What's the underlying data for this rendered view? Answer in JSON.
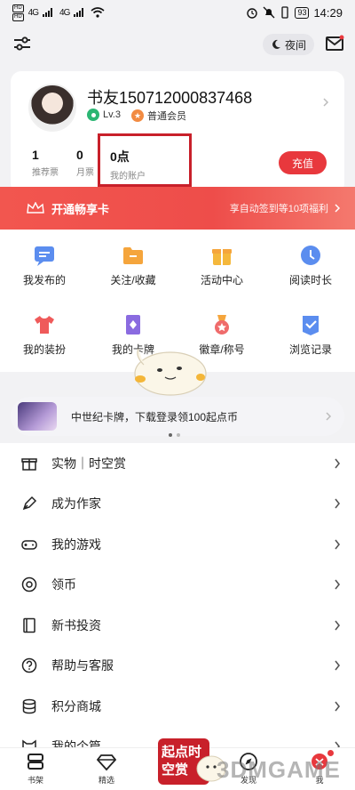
{
  "status_bar": {
    "sim1": "HD",
    "sim2": "HD",
    "signal1": "4G",
    "signal2": "4G",
    "battery": "93",
    "time": "14:29"
  },
  "topbar": {
    "night_label": "夜间"
  },
  "profile": {
    "username": "书友150712000837468",
    "level": "Lv.3",
    "membership": "普通会员",
    "stats": [
      {
        "value": "1",
        "label": "推荐票"
      },
      {
        "value": "0",
        "label": "月票"
      },
      {
        "value": "0点",
        "label": "我的账户"
      }
    ],
    "recharge_label": "充值"
  },
  "vip_banner": {
    "title": "开通畅享卡",
    "benefit": "享自动签到等10项福利"
  },
  "grid": [
    {
      "label": "我发布的",
      "icon": "message-icon",
      "color": "#5b8def"
    },
    {
      "label": "关注/收藏",
      "icon": "folder-icon",
      "color": "#f5a53c"
    },
    {
      "label": "活动中心",
      "icon": "gift-icon",
      "color": "#f5b83c"
    },
    {
      "label": "阅读时长",
      "icon": "clock-icon",
      "color": "#5b8def"
    },
    {
      "label": "我的装扮",
      "icon": "shirt-icon",
      "color": "#ef5a5a"
    },
    {
      "label": "我的卡牌",
      "icon": "card-icon",
      "color": "#8a6be0"
    },
    {
      "label": "徽章/称号",
      "icon": "medal-icon",
      "color": "#ef6b6b"
    },
    {
      "label": "浏览记录",
      "icon": "history-icon",
      "color": "#5b8def"
    }
  ],
  "promo": {
    "text": "中世纪卡牌，下载登录领100起点币"
  },
  "list": [
    {
      "label": "实物｜时空赏",
      "icon": "gift-box-icon"
    },
    {
      "label": "成为作家",
      "icon": "pen-icon"
    },
    {
      "label": "我的游戏",
      "icon": "gamepad-icon"
    },
    {
      "label": "领币",
      "icon": "coin-icon"
    },
    {
      "label": "新书投资",
      "icon": "book-icon"
    },
    {
      "label": "帮助与客服",
      "icon": "help-icon"
    },
    {
      "label": "积分商城",
      "icon": "database-icon"
    },
    {
      "label": "我的个篇",
      "icon": "cat-icon"
    }
  ],
  "bottom_nav": [
    {
      "label": "书架",
      "icon": "bookshelf-icon"
    },
    {
      "label": "精选",
      "icon": "diamond-icon"
    },
    {
      "label": "发现",
      "icon": "compass-icon"
    },
    {
      "label": "我",
      "icon": "me-icon"
    }
  ],
  "event_tag": "起点时空赏",
  "watermark": "3DMGAME",
  "colors": {
    "accent_red": "#e8383d",
    "page_bg": "#f2f2f4",
    "highlight_box": "#c8202a"
  }
}
